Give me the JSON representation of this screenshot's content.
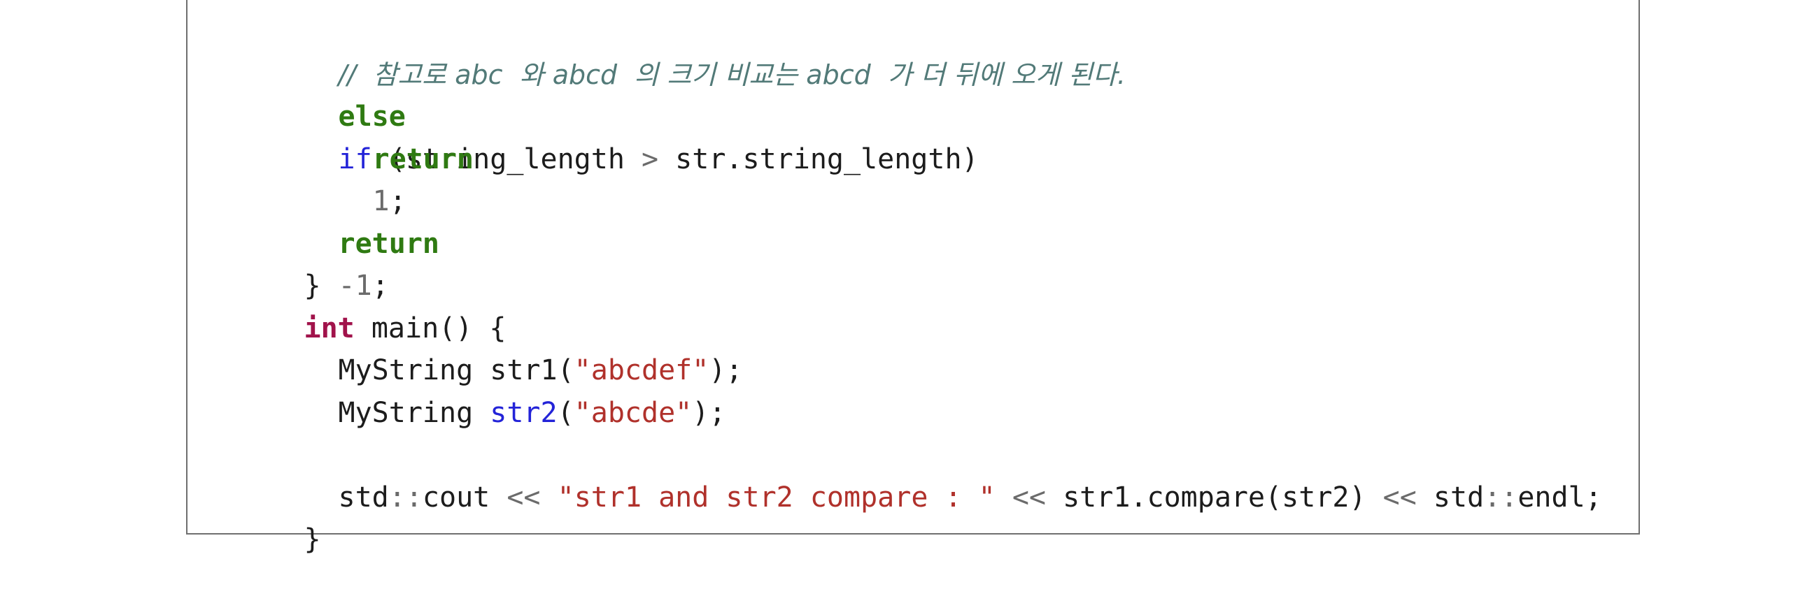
{
  "code": {
    "line1": {
      "comment": "//  참고로 abc  와 abcd  의 크기 비교는 abcd  가 더 뒤에 오게 된다."
    },
    "line2": {
      "kw_else": "else",
      "kw_if": "if",
      "cond_open": " (string_length ",
      "op_gt": ">",
      "cond_rest": " str.string_length)"
    },
    "line3": {
      "kw_return": "return",
      "num": "1",
      "semi": ";"
    },
    "line5": {
      "kw_return": "return",
      "num": "-1",
      "semi": ";"
    },
    "line6": {
      "brace": "}"
    },
    "line7": {
      "kw_int": "int",
      "rest": " main() {"
    },
    "line8": {
      "decl": "MyString str1(",
      "str": "\"abcdef\"",
      "close": ");"
    },
    "line9": {
      "type": "MyString ",
      "fn": "str2",
      "open": "(",
      "str": "\"abcde\"",
      "close": ");"
    },
    "line11": {
      "std1": "std",
      "scope1": "::",
      "cout": "cout ",
      "shl1": "<<",
      "space1": " ",
      "str": "\"str1 and str2 compare : \"",
      "space2": " ",
      "shl2": "<<",
      "call": " str1.compare(str2) ",
      "shl3": "<<",
      "std2": " std",
      "scope2": "::",
      "endl": "endl;"
    },
    "line12": {
      "brace": "}"
    }
  },
  "colors": {
    "keyword_control": "#2f7a12",
    "keyword_if": "#2323d8",
    "keyword_type": "#a1134b",
    "string": "#b0312b",
    "comment": "#527a78",
    "operator": "#6b6b6b"
  }
}
